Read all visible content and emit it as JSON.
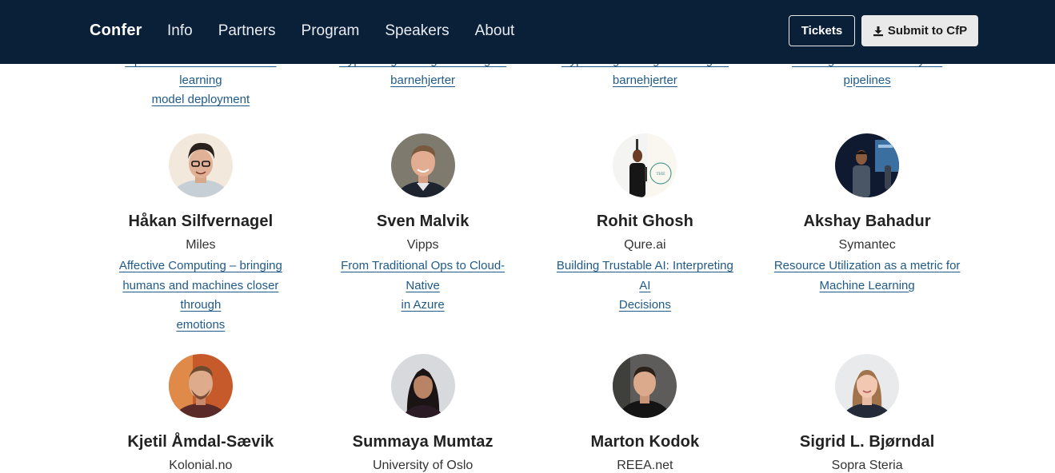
{
  "navbar": {
    "brand": "Confer",
    "links": [
      "Info",
      "Partners",
      "Program",
      "Speakers",
      "About"
    ],
    "tickets_label": "Tickets",
    "cfp_label": "Submit to CfP",
    "cfp_icon": "download-icon",
    "background": "#0a1f38"
  },
  "top_talks": [
    {
      "line1": "Open standards for machine learning",
      "line2": "model deployment"
    },
    {
      "line1": "Dyp læring for segmentering av",
      "line2": "barnehjerter"
    },
    {
      "line1": "Dyp læring for segmentering av",
      "line2": "barnehjerter"
    },
    {
      "line1": "Building serverless analytics",
      "line2": "pipelines"
    }
  ],
  "speakers_row1": [
    {
      "name": "Håkan Silfvernagel",
      "company": "Miles",
      "talk": [
        "Affective Computing – bringing",
        "humans and machines closer through",
        "emotions"
      ]
    },
    {
      "name": "Sven Malvik",
      "company": "Vipps",
      "talk": [
        "From Traditional Ops to Cloud-Native",
        "in Azure"
      ]
    },
    {
      "name": "Rohit Ghosh",
      "company": "Qure.ai",
      "talk": [
        "Building Trustable AI: Interpreting AI",
        "Decisions"
      ]
    },
    {
      "name": "Akshay Bahadur",
      "company": "Symantec",
      "talk": [
        "Resource Utilization as a metric for",
        "Machine Learning"
      ]
    }
  ],
  "speakers_row2": [
    {
      "name": "Kjetil Åmdal-Sævik",
      "company": "Kolonial.no"
    },
    {
      "name": "Summaya Mumtaz",
      "company": "University of Oslo"
    },
    {
      "name": "Marton Kodok",
      "company": "REEA.net"
    },
    {
      "name": "Sigrid L. Bjørndal",
      "company": "Sopra Steria"
    }
  ],
  "colors": {
    "link": "#1f5a8a",
    "text": "#222222",
    "cfp_button": "#e9e9e9"
  }
}
